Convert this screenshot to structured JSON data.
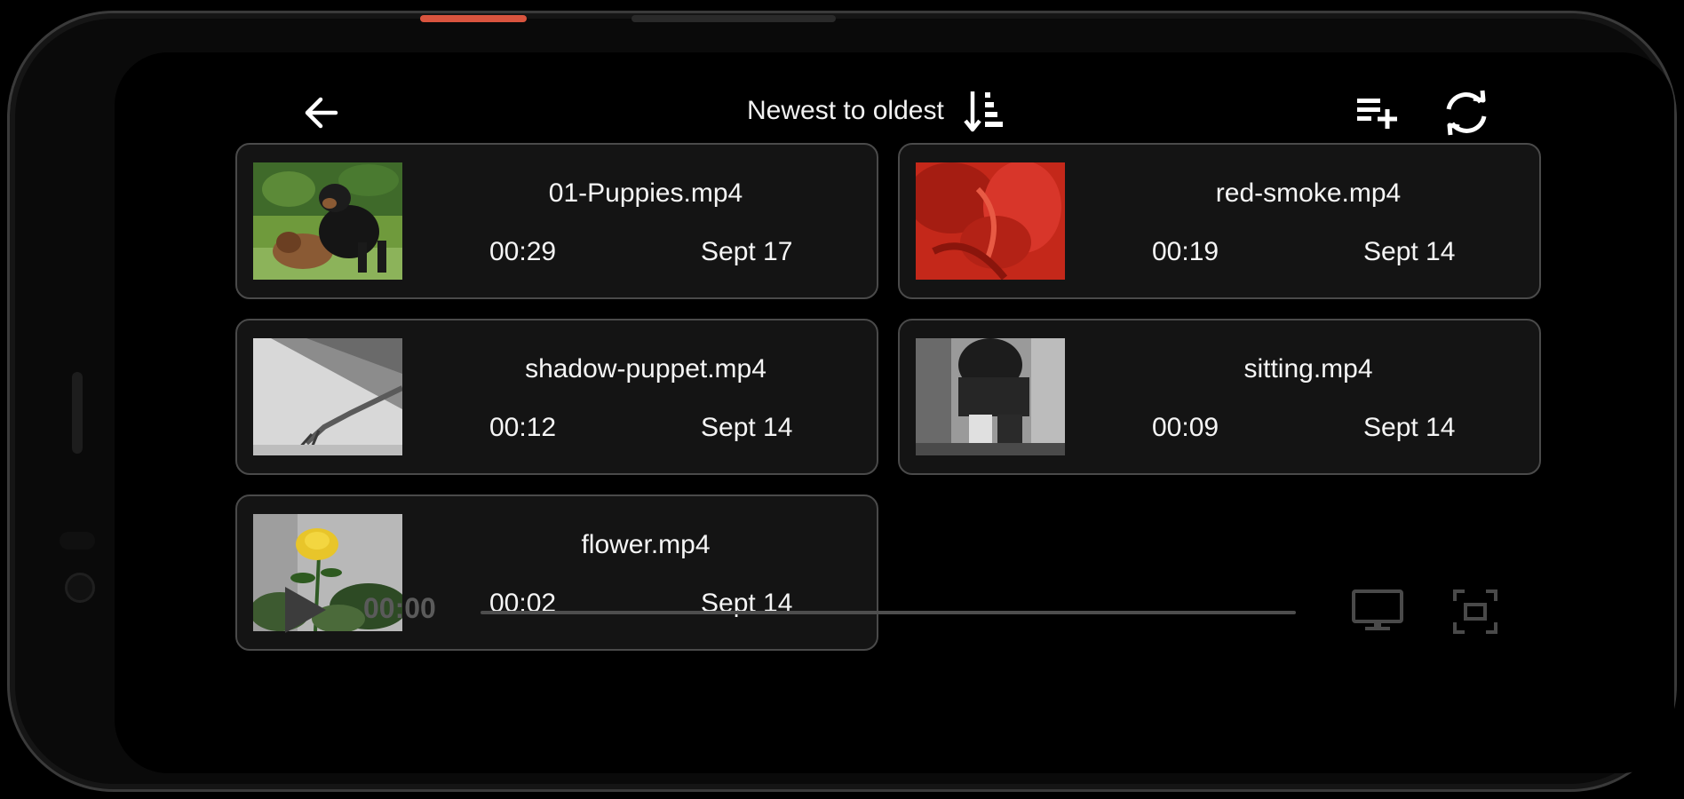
{
  "toolbar": {
    "back_icon": "arrow-left-icon",
    "sort_label": "Newest to oldest",
    "sort_icon": "sort-descending-icon",
    "playlist_icon": "playlist-add-icon",
    "refresh_icon": "refresh-icon"
  },
  "videos": [
    {
      "title": "01-Puppies.mp4",
      "duration": "00:29",
      "date": "Sept 17",
      "thumb": "puppies"
    },
    {
      "title": "red-smoke.mp4",
      "duration": "00:19",
      "date": "Sept 14",
      "thumb": "red-smoke"
    },
    {
      "title": "shadow-puppet.mp4",
      "duration": "00:12",
      "date": "Sept 14",
      "thumb": "shadow-puppet"
    },
    {
      "title": "sitting.mp4",
      "duration": "00:09",
      "date": "Sept 14",
      "thumb": "sitting"
    },
    {
      "title": "flower.mp4",
      "duration": "00:02",
      "date": "Sept 14",
      "thumb": "flower"
    }
  ],
  "player": {
    "current_time": "00:00",
    "progress": 0,
    "play_icon": "play-icon",
    "cast_icon": "monitor-icon",
    "fit_icon": "fit-screen-icon"
  },
  "colors": {
    "card_bg": "#141414",
    "card_border": "#4a4a4a",
    "accent_red": "#d9543e",
    "muted": "#5a5a5a"
  }
}
